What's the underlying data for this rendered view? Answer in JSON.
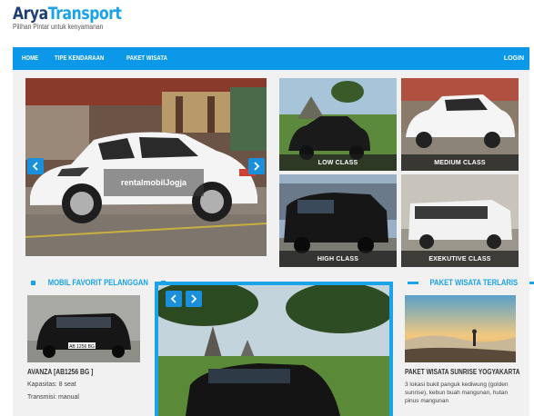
{
  "brand": {
    "title_part1": "Arya",
    "title_part2": "Transport",
    "tagline": "Pilihan Pintar untuk kenyamanan"
  },
  "nav": {
    "items": [
      "HOME",
      "TIPE KENDARAAN",
      "PAKET WISATA"
    ],
    "login": "LOGIN"
  },
  "hero": {
    "caption_part1": "rentalmobil",
    "caption_part2": "Jogja"
  },
  "classes": [
    {
      "label": "LOW CLASS"
    },
    {
      "label": "MEDIUM CLASS"
    },
    {
      "label": "HIGH CLASS"
    },
    {
      "label": "EXEKUTIVE CLASS"
    }
  ],
  "favorite": {
    "heading": "MOBIL FAVORIT PELANGGAN",
    "car_name": "AVANZA [AB1256 BG ]",
    "capacity": "Kapasitas: 8 seat",
    "transmission": "Transmisi: manual",
    "plate": "AB 1256 BG"
  },
  "tour": {
    "heading": "PAKET WISATA TERLARIS",
    "name": "PAKET WISATA SUNRISE YOGYAKARTA",
    "description": "3 lokasi bukit panguk kediwung (golden sunrise), kebun buah mangunan, hutan pinus mangunan"
  },
  "colors": {
    "brand_dark": "#1f3f73",
    "accent": "#1aa3e8",
    "nav_bg": "#0c98e8"
  },
  "icons": {
    "prev": "chevron-left-icon",
    "next": "chevron-right-icon"
  }
}
